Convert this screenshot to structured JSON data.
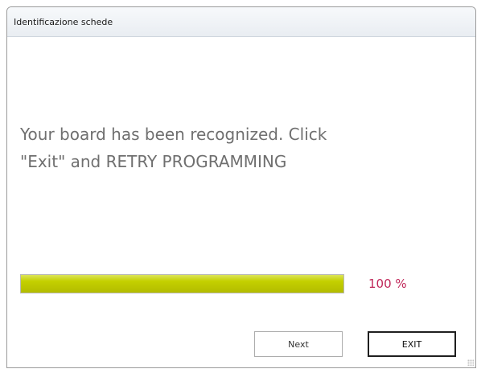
{
  "window": {
    "title": "Identificazione schede"
  },
  "message": {
    "line1": "Your board has been recognized. Click",
    "line2": "\"Exit\" and RETRY PROGRAMMING"
  },
  "progress": {
    "value_percent": 100,
    "label": "100 %",
    "fill_color": "#bcc600",
    "label_color": "#c0285a"
  },
  "buttons": {
    "next_label": "Next",
    "exit_label": "EXIT"
  }
}
